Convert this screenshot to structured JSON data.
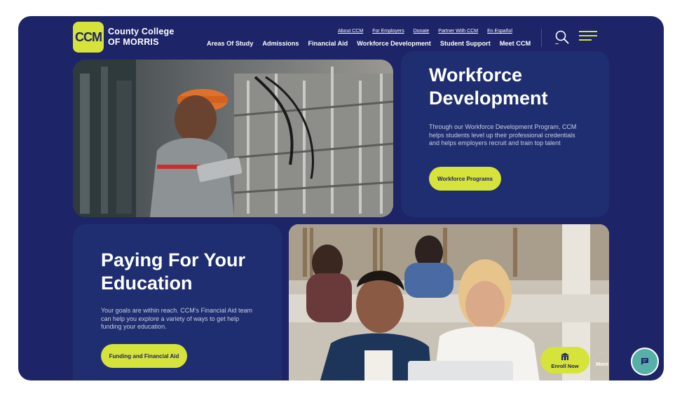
{
  "logo": {
    "mark": "CCM",
    "line1": "County College",
    "line2": "of Morris"
  },
  "utility_nav": [
    "About CCM",
    "For Employers",
    "Donate",
    "Partner With CCM",
    "En Español"
  ],
  "main_nav": [
    "Areas Of Study",
    "Admissions",
    "Financial Aid",
    "Workforce Development",
    "Student Support",
    "Meet CCM"
  ],
  "icons": {
    "search": "search-icon",
    "menu": "hamburger-menu-icon",
    "enroll": "building-icon",
    "more": "dots-icon",
    "chat": "chat-icon"
  },
  "workforce": {
    "title_line1": "Workforce",
    "title_line2": "Development",
    "body": "Through our Workforce Development Program, CCM helps students level up their professional credentials and helps employers recruit and train top talent",
    "button": "Workforce Programs"
  },
  "aid": {
    "title_line1": "Paying For Your",
    "title_line2": "Education",
    "body": "Your goals are within reach. CCM's Financial Aid team can help you explore a variety of ways to get help funding your education.",
    "button": "Funding and Financial Aid"
  },
  "floating": {
    "enroll": "Enroll Now",
    "more": "More"
  },
  "colors": {
    "navy": "#1d2467",
    "card": "#1f2e70",
    "accent": "#d5e33a",
    "chat": "#56b0a8"
  }
}
